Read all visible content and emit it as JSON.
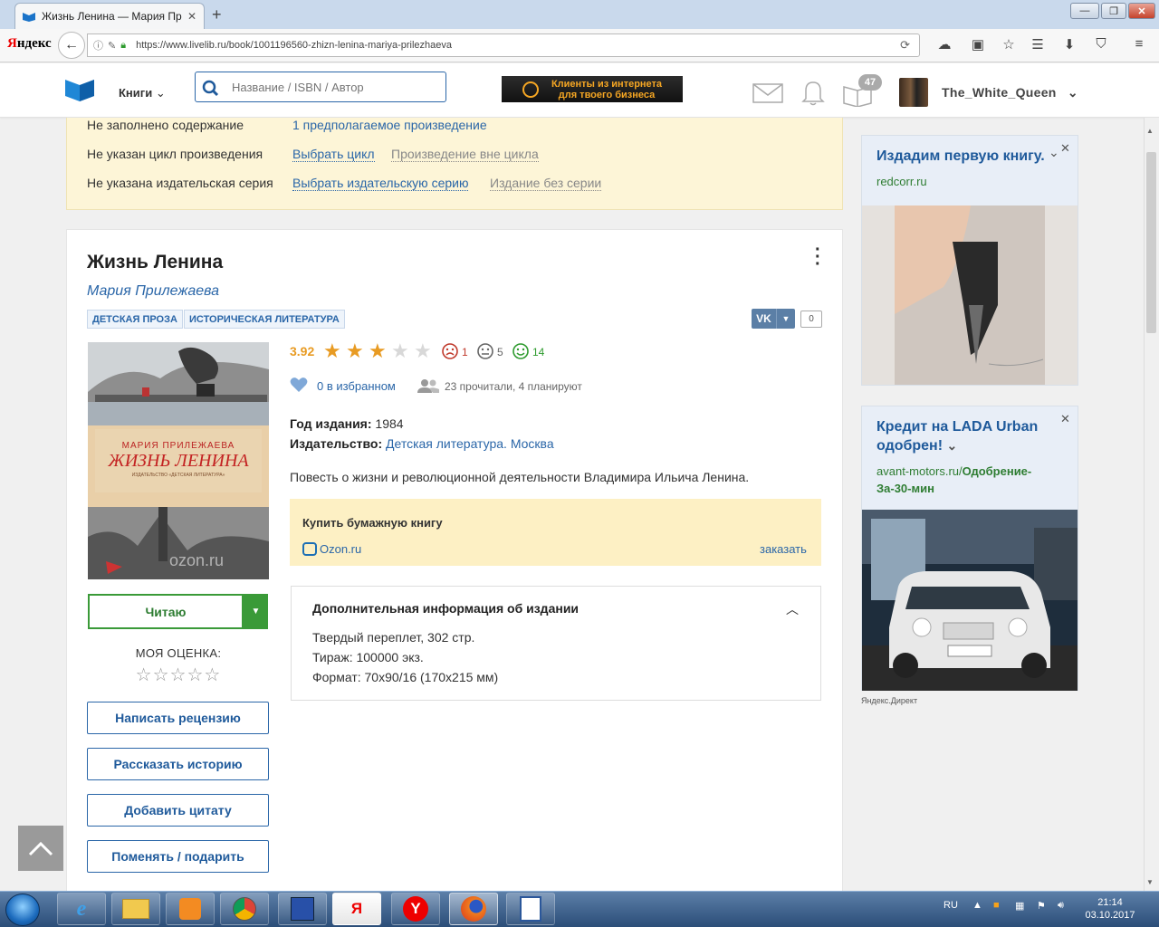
{
  "browser": {
    "tab_title": "Жизнь Ленина — Мария Пр",
    "tab_close": "✕",
    "new_tab": "+",
    "yandex_logo_prefix": "Я",
    "yandex_logo_rest": "ндекс",
    "url": "https://www.livelib.ru/book/1001196560-zhizn-lenina-mariya-prilezhaeva",
    "window_minimize": "—",
    "window_restore": "❐",
    "window_close": "✕"
  },
  "header": {
    "books_menu": "Книги",
    "search_placeholder": "Название / ISBN / Автор",
    "banner_line1": "Клиенты из интернета",
    "banner_line2": "для твоего бизнеса",
    "notifications_count": "47",
    "username": "The_White_Queen"
  },
  "warnings": [
    {
      "label": "Не заполнено содержание",
      "link": "1 предполагаемое произведение",
      "alt": ""
    },
    {
      "label": "Не указан цикл произведения",
      "link": "Выбрать цикл",
      "alt": "Произведение вне цикла"
    },
    {
      "label": "Не указана издательская серия",
      "link": "Выбрать издательскую серию",
      "alt": "Издание без серии"
    }
  ],
  "book": {
    "title": "Жизнь Ленина",
    "author": "Мария Прилежаева",
    "genres": [
      "ДЕТСКАЯ ПРОЗА",
      "ИСТОРИЧЕСКАЯ ЛИТЕРАТУРА"
    ],
    "share_vk": "VK",
    "share_count": "0",
    "cover": {
      "author": "МАРИЯ ПРИЛЕЖАЕВА",
      "title": "ЖИЗНЬ ЛЕНИНА",
      "publisher": "ИЗДАТЕЛЬСТВО «ДЕТСКАЯ ЛИТЕРАТУРА»",
      "watermark": "ozon.ru"
    },
    "rating": "3.92",
    "rating_value": 3.92,
    "rating_max": 5,
    "negative": "1",
    "neutral": "5",
    "positive": "14",
    "favorites": "0 в избранном",
    "readers": "23 прочитали, 4 планируют",
    "year_label": "Год издания:",
    "year": "1984",
    "publisher_label": "Издательство:",
    "publisher": "Детская литература.",
    "city": "Москва",
    "description": "Повесть о жизни и революционной деятельности Владимира Ильича Ленина.",
    "buy_title": "Купить бумажную книгу",
    "buy_shop": "Ozon.ru",
    "buy_order": "заказать",
    "info_title": "Дополнительная информация об издании",
    "info_lines": [
      "Твердый переплет, 302 стр.",
      "Тираж: 100000 экз.",
      "Формат: 70x90/16 (170x215 мм)"
    ]
  },
  "actions": {
    "reading": "Читаю",
    "my_score": "МОЯ ОЦЕНКА:",
    "my_stars": "☆☆☆☆☆",
    "write_review": "Написать рецензию",
    "tell_story": "Рассказать историю",
    "add_quote": "Добавить цитату",
    "exchange": "Поменять / подарить"
  },
  "ads": [
    {
      "title": "Издадим первую книгу.",
      "domain": "redcorr.ru",
      "domain_path": ""
    },
    {
      "title": "Кредит на LADA Urban одобрен!",
      "domain": "avant-motors.ru/",
      "domain_path": "Одобрение-За-30-мин"
    }
  ],
  "ads_label": "Яндекс.Директ",
  "taskbar": {
    "lang": "RU",
    "time": "21:14",
    "date": "03.10.2017"
  },
  "colors": {
    "brand": "#2a66a8",
    "read_green": "#3a9a38",
    "rating_orange": "#e89b23",
    "warn_bg": "#fdf5d7",
    "buy_bg": "#fdf0c4"
  }
}
